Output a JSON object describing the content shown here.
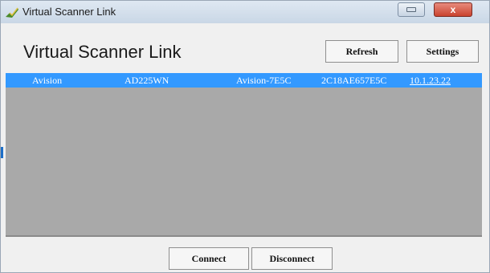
{
  "window": {
    "title": "Virtual Scanner Link",
    "close_glyph": "x",
    "icon": "scanner-app-icon"
  },
  "header": {
    "title": "Virtual Scanner Link",
    "refresh_label": "Refresh",
    "settings_label": "Settings"
  },
  "scanner_list": {
    "rows": [
      {
        "vendor": "Avision",
        "model": "AD225WN",
        "name": "Avision-7E5C",
        "mac": "2C18AE657E5C",
        "ip": "10.1.23.22",
        "selected": true
      }
    ]
  },
  "footer": {
    "connect_label": "Connect",
    "disconnect_label": "Disconnect"
  },
  "colors": {
    "selection": "#3399ff",
    "list_background": "#a9a9a9",
    "window_background": "#f0f0f0",
    "close_button": "#c9432f"
  }
}
